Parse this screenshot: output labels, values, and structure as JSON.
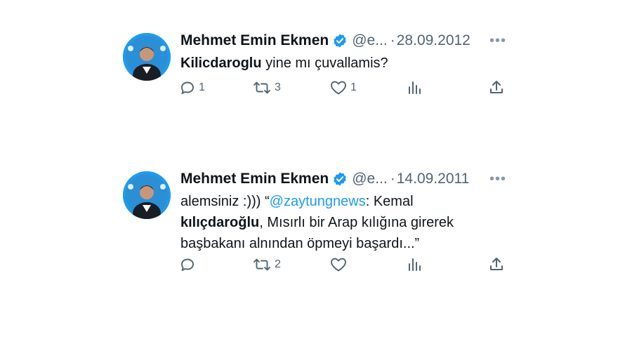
{
  "colors": {
    "accent": "#1d9bf0",
    "muted": "#536471",
    "text": "#0f1419"
  },
  "tweets": [
    {
      "author_name": "Mehmet Emin Ekmen",
      "handle": "@e...",
      "separator": "·",
      "date": "28.09.2012",
      "more_icon": "ellipsis-icon",
      "text_bold": "Kilicdaroglu",
      "text_rest": " yine mı çuvallamis?",
      "actions": {
        "reply_count": "1",
        "retweet_count": "3",
        "like_count": "1"
      }
    },
    {
      "author_name": "Mehmet Emin Ekmen",
      "handle": "@e...",
      "separator": "·",
      "date": "14.09.2011",
      "more_icon": "ellipsis-icon",
      "text_part1": "alemsiniz :))) “",
      "mention": "@zaytungnews",
      "text_part2": ": Kemal",
      "text_bold": "kılıçdaroğlu",
      "text_part3": ", Mısırlı bir Arap kılığına girerek başbakanı alnından öpmeyi başardı...”",
      "actions": {
        "reply_count": "",
        "retweet_count": "2",
        "like_count": ""
      }
    }
  ]
}
